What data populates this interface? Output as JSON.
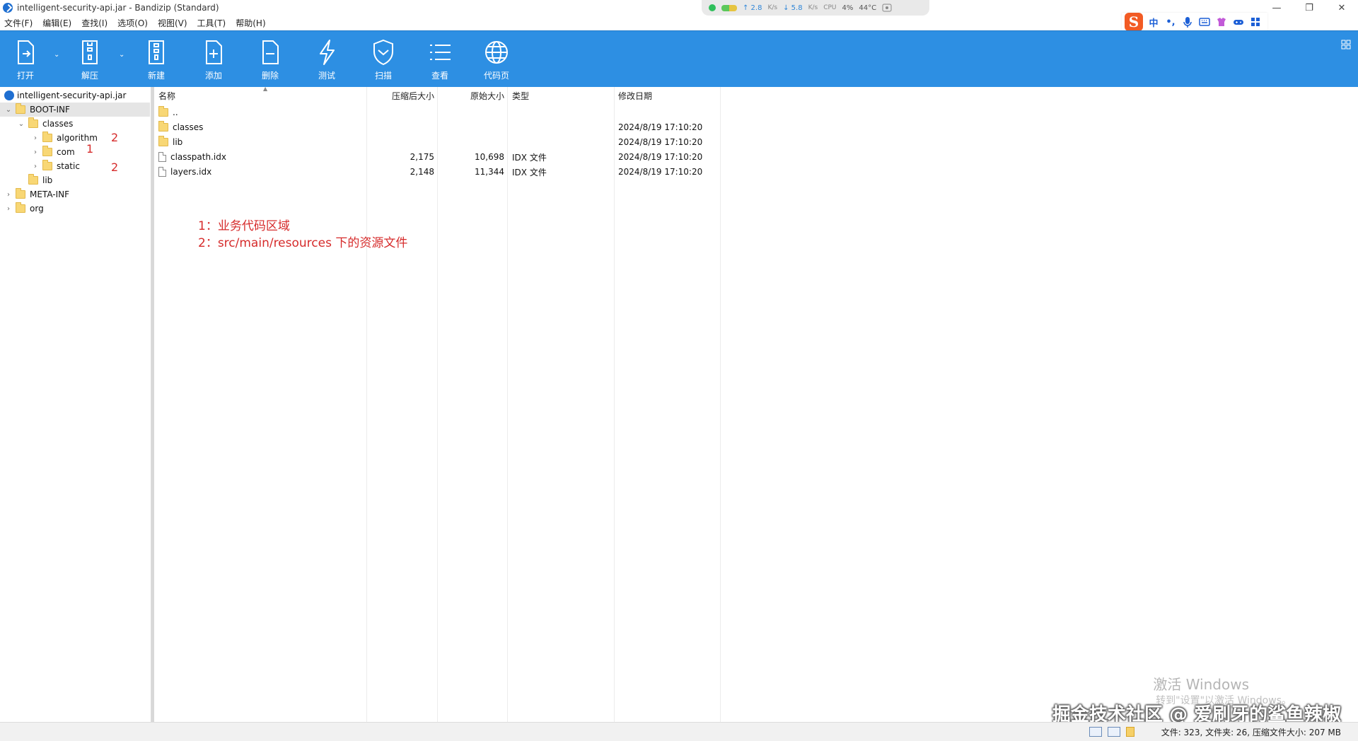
{
  "window": {
    "title": "intelligent-security-api.jar - Bandizip (Standard)",
    "minimize": "—",
    "restore": "❐",
    "close": "✕"
  },
  "sysmon": {
    "up_value": "↑ 2.8",
    "up_unit": "K/s",
    "down_value": "↓ 5.8",
    "down_unit": "K/s",
    "cpu_label": "CPU",
    "cpu_value": "4%",
    "temp": "44°C"
  },
  "ime": {
    "logo": "S",
    "lang": "中",
    "punct": "•,"
  },
  "menu": [
    "文件(F)",
    "编辑(E)",
    "查找(I)",
    "选项(O)",
    "视图(V)",
    "工具(T)",
    "帮助(H)"
  ],
  "toolbar": {
    "open": "打开",
    "extract": "解压",
    "new": "新建",
    "add": "添加",
    "delete": "删除",
    "test": "测试",
    "scan": "扫描",
    "view": "查看",
    "codepage": "代码页",
    "dropdown": "⌄"
  },
  "tree": {
    "root": "intelligent-security-api.jar",
    "boot_inf": "BOOT-INF",
    "classes": "classes",
    "algorithm": "algorithm",
    "com": "com",
    "static": "static",
    "lib": "lib",
    "meta_inf": "META-INF",
    "org": "org"
  },
  "tree_annotations": {
    "algorithm": "2",
    "com": "1",
    "static": "2"
  },
  "columns": {
    "name": "名称",
    "compressed": "压缩后大小",
    "original": "原始大小",
    "type": "类型",
    "modified": "修改日期"
  },
  "files": [
    {
      "name": "..",
      "compressed": "",
      "original": "",
      "type": "",
      "modified": "",
      "kind": "folder"
    },
    {
      "name": "classes",
      "compressed": "",
      "original": "",
      "type": "",
      "modified": "2024/8/19 17:10:20",
      "kind": "folder"
    },
    {
      "name": "lib",
      "compressed": "",
      "original": "",
      "type": "",
      "modified": "2024/8/19 17:10:20",
      "kind": "folder"
    },
    {
      "name": "classpath.idx",
      "compressed": "2,175",
      "original": "10,698",
      "type": "IDX 文件",
      "modified": "2024/8/19 17:10:20",
      "kind": "file"
    },
    {
      "name": "layers.idx",
      "compressed": "2,148",
      "original": "11,344",
      "type": "IDX 文件",
      "modified": "2024/8/19 17:10:20",
      "kind": "file"
    }
  ],
  "notes": {
    "line1": "1：业务代码区域",
    "line2": "2：src/main/resources 下的资源文件"
  },
  "watermark": {
    "activate_title": "激活 Windows",
    "activate_sub": "转到\"设置\"以激活 Windows。",
    "site": "掘金技术社区 @ 爱刷牙的鲨鱼辣椒"
  },
  "status": {
    "summary": "文件: 323, 文件夹: 26, 压缩文件大小: 207 MB"
  },
  "colors": {
    "toolbar_blue": "#2d8fe3",
    "annotation_red": "#d62b2b"
  }
}
